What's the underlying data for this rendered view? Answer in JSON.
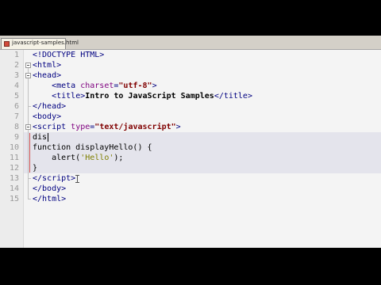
{
  "tab": {
    "label": "javascript-samples.html"
  },
  "lines": [
    {
      "num": "1",
      "tokens": [
        {
          "c": "t-tag",
          "t": "<!DOCTYPE HTML>"
        }
      ]
    },
    {
      "num": "2",
      "tokens": [
        {
          "c": "t-tag",
          "t": "<html>"
        }
      ]
    },
    {
      "num": "3",
      "tokens": [
        {
          "c": "t-tag",
          "t": "<head>"
        }
      ]
    },
    {
      "num": "4",
      "tokens": [
        {
          "c": "t-plain",
          "t": "    "
        },
        {
          "c": "t-tag",
          "t": "<meta "
        },
        {
          "c": "t-attr",
          "t": "charset"
        },
        {
          "c": "t-tag",
          "t": "="
        },
        {
          "c": "t-str",
          "t": "\"utf-8\""
        },
        {
          "c": "t-tag",
          "t": ">"
        }
      ]
    },
    {
      "num": "5",
      "tokens": [
        {
          "c": "t-plain",
          "t": "    "
        },
        {
          "c": "t-tag",
          "t": "<title>"
        },
        {
          "c": "t-text",
          "t": "Intro to JavaScript Samples"
        },
        {
          "c": "t-tag",
          "t": "</title>"
        }
      ]
    },
    {
      "num": "6",
      "tokens": [
        {
          "c": "t-tag",
          "t": "</head>"
        }
      ]
    },
    {
      "num": "7",
      "tokens": [
        {
          "c": "t-tag",
          "t": "<body>"
        }
      ]
    },
    {
      "num": "8",
      "tokens": [
        {
          "c": "t-tag",
          "t": "<script "
        },
        {
          "c": "t-attr",
          "t": "type"
        },
        {
          "c": "t-tag",
          "t": "="
        },
        {
          "c": "t-str",
          "t": "\"text/javascript\""
        },
        {
          "c": "t-tag",
          "t": ">"
        }
      ]
    },
    {
      "num": "9",
      "tokens": [
        {
          "c": "t-plain",
          "t": "dis"
        }
      ]
    },
    {
      "num": "10",
      "tokens": [
        {
          "c": "t-kw",
          "t": "function displayHello() {"
        }
      ]
    },
    {
      "num": "11",
      "tokens": [
        {
          "c": "t-plain",
          "t": "    alert("
        },
        {
          "c": "t-sq",
          "t": "'Hello'"
        },
        {
          "c": "t-plain",
          "t": ");"
        }
      ]
    },
    {
      "num": "12",
      "tokens": [
        {
          "c": "t-plain",
          "t": "}"
        }
      ]
    },
    {
      "num": "13",
      "tokens": [
        {
          "c": "t-tag",
          "t": "</"
        },
        {
          "c": "t-tag",
          "t": "script"
        },
        {
          "c": "t-tag",
          "t": ">"
        }
      ]
    },
    {
      "num": "14",
      "tokens": [
        {
          "c": "t-tag",
          "t": "</body>"
        }
      ]
    },
    {
      "num": "15",
      "tokens": [
        {
          "c": "t-tag",
          "t": "</html>"
        }
      ]
    }
  ],
  "colors": {
    "background": "#000000",
    "editor": "#f4f4f4",
    "current_line": "#e4e4ec"
  },
  "icons": {
    "tab": "html-file-icon",
    "fold": "fold-toggle-icon",
    "cursor": "ibeam-cursor-icon"
  }
}
